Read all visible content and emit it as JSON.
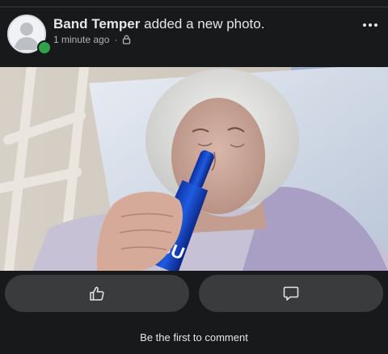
{
  "post": {
    "author": "Band Temper",
    "action": "added a new photo.",
    "timestamp": "1 minute ago",
    "separator": "·",
    "privacy_icon": "lock-icon",
    "more_icon": "more-dots-icon",
    "avatar_icon": "default-avatar-icon",
    "online_status": "online"
  },
  "photo": {
    "bottle_text": "BU"
  },
  "actions": {
    "like_icon": "thumbs-up-icon",
    "comment_icon": "comment-bubble-icon"
  },
  "comments": {
    "prompt": "Be the first to comment"
  },
  "colors": {
    "background": "#18191a",
    "button": "#3a3b3c",
    "online": "#31a24c"
  }
}
